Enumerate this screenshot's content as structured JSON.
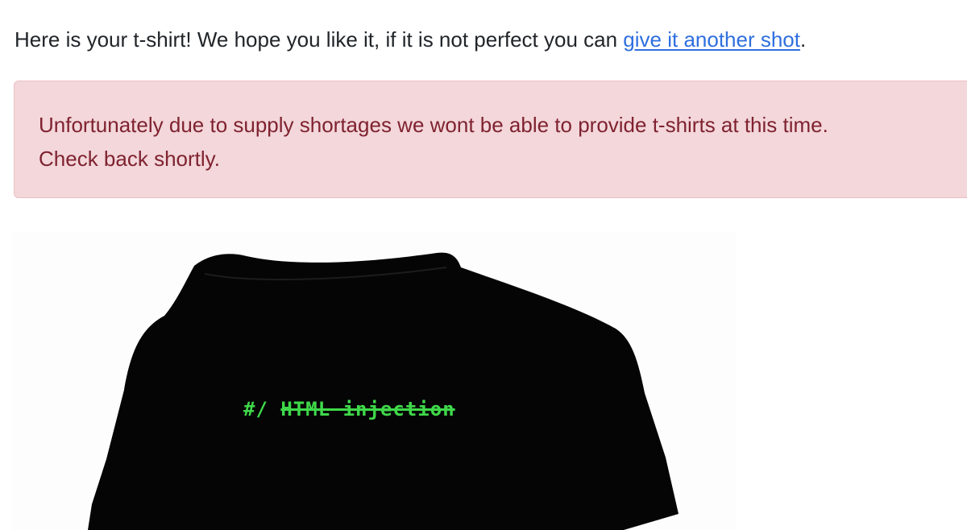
{
  "intro": {
    "text_before": "Here is your t-shirt! We hope you like it, if it is not perfect you can ",
    "link_label": "give it another shot",
    "text_after": "."
  },
  "alert": {
    "line1": "Unfortunately due to supply shortages we wont be able to provide t-shirts at this time.",
    "line2": "Check back shortly."
  },
  "shirt": {
    "prefix": "#/ ",
    "struck_text": "HTML injection"
  },
  "colors": {
    "link": "#2f6fdf",
    "alert_bg": "#f3d7da",
    "alert_text": "#7f2230",
    "shirt": "#050505",
    "shirt_print": "#3fd84a"
  }
}
